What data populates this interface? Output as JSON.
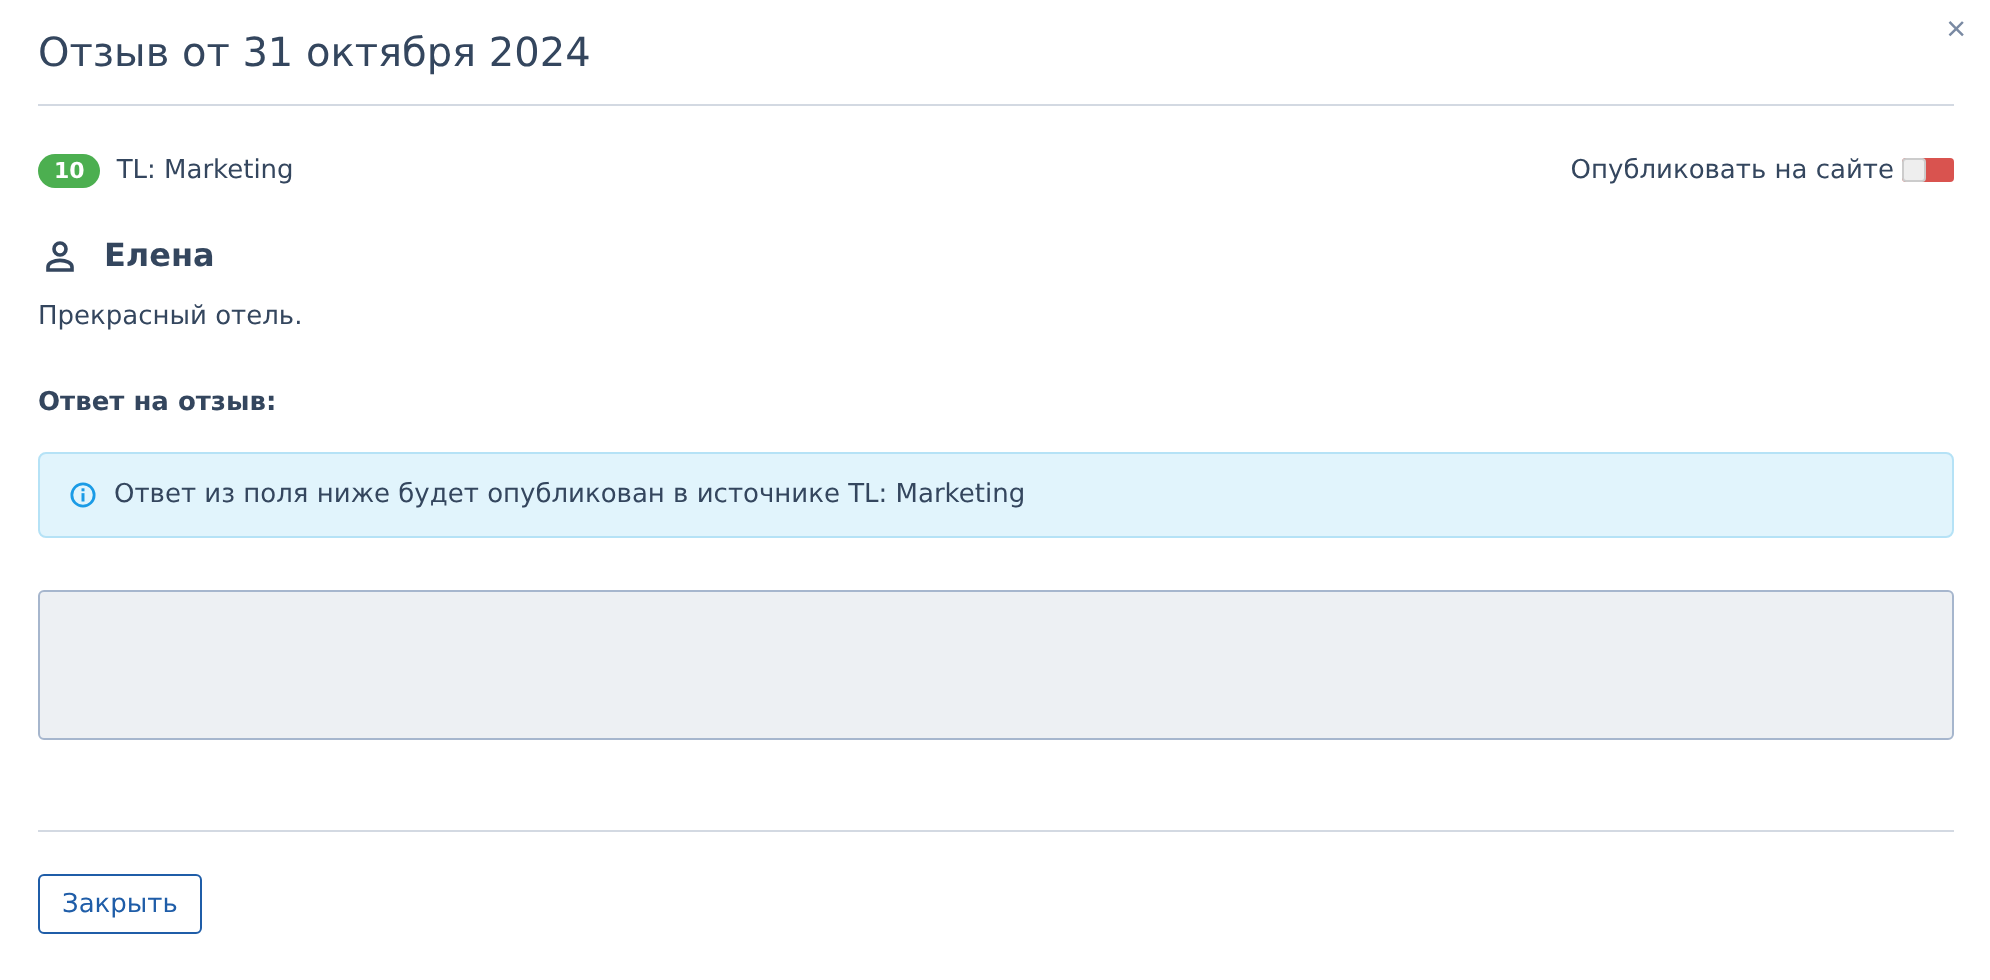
{
  "dialog": {
    "title": "Отзыв от 31 октября 2024",
    "close": "×"
  },
  "review": {
    "score": "10",
    "source": "TL: Marketing",
    "publish_label": "Опубликовать на сайте",
    "publish_on": false,
    "author": "Елена",
    "text": "Прекрасный отель."
  },
  "reply": {
    "label": "Ответ на отзыв:",
    "notice": "Ответ из поля ниже будет опубликован в источнике TL: Marketing"
  },
  "buttons": [
    "Закрыть"
  ]
}
